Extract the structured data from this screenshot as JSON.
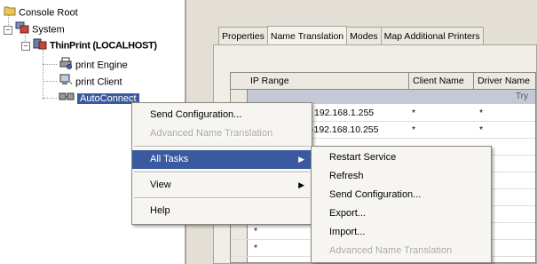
{
  "tree": {
    "root_label": "Console Root",
    "system_label": "System",
    "server_label": "ThinPrint (LOCALHOST)",
    "children": [
      {
        "label": "print Engine",
        "icon": "printer-gear-icon"
      },
      {
        "label": "print Client",
        "icon": "computer-client-icon"
      },
      {
        "label": "AutoConnect",
        "icon": "connect-icon",
        "selected": true
      }
    ]
  },
  "tabs": [
    "Properties",
    "Name Translation",
    "Modes",
    "Map Additional Printers"
  ],
  "active_tab": "Name Translation",
  "grid": {
    "columns": [
      "IP Range",
      "Client Name",
      "Driver Name"
    ],
    "band_text": "Try",
    "rows": [
      {
        "ip": "192.168.1.255",
        "client": "*",
        "driver": "*"
      },
      {
        "ip": "-192.168.10.255",
        "client": "*",
        "driver": "*"
      },
      {
        "ip": "",
        "client": "",
        "driver": ""
      },
      {
        "ip": "",
        "client": "",
        "driver": ""
      },
      {
        "ip": "",
        "client": "",
        "driver": ""
      },
      {
        "ip": "",
        "client": "",
        "driver": ""
      },
      {
        "ip": "",
        "client": "",
        "driver": ""
      },
      {
        "ip": "*",
        "client": "",
        "driver": ""
      },
      {
        "ip": "*",
        "client": "",
        "driver": ""
      }
    ]
  },
  "context_menu": {
    "send_configuration": "Send Configuration...",
    "advanced_name_translation": "Advanced Name Translation",
    "all_tasks": "All Tasks",
    "view": "View",
    "help": "Help"
  },
  "submenu": {
    "restart_service": "Restart Service",
    "refresh": "Refresh",
    "send_configuration": "Send Configuration...",
    "export": "Export...",
    "import": "Import...",
    "advanced_name_translation": "Advanced Name Translation"
  },
  "colors": {
    "selection": "#3a5aa0",
    "band": "#c5c9d6"
  }
}
